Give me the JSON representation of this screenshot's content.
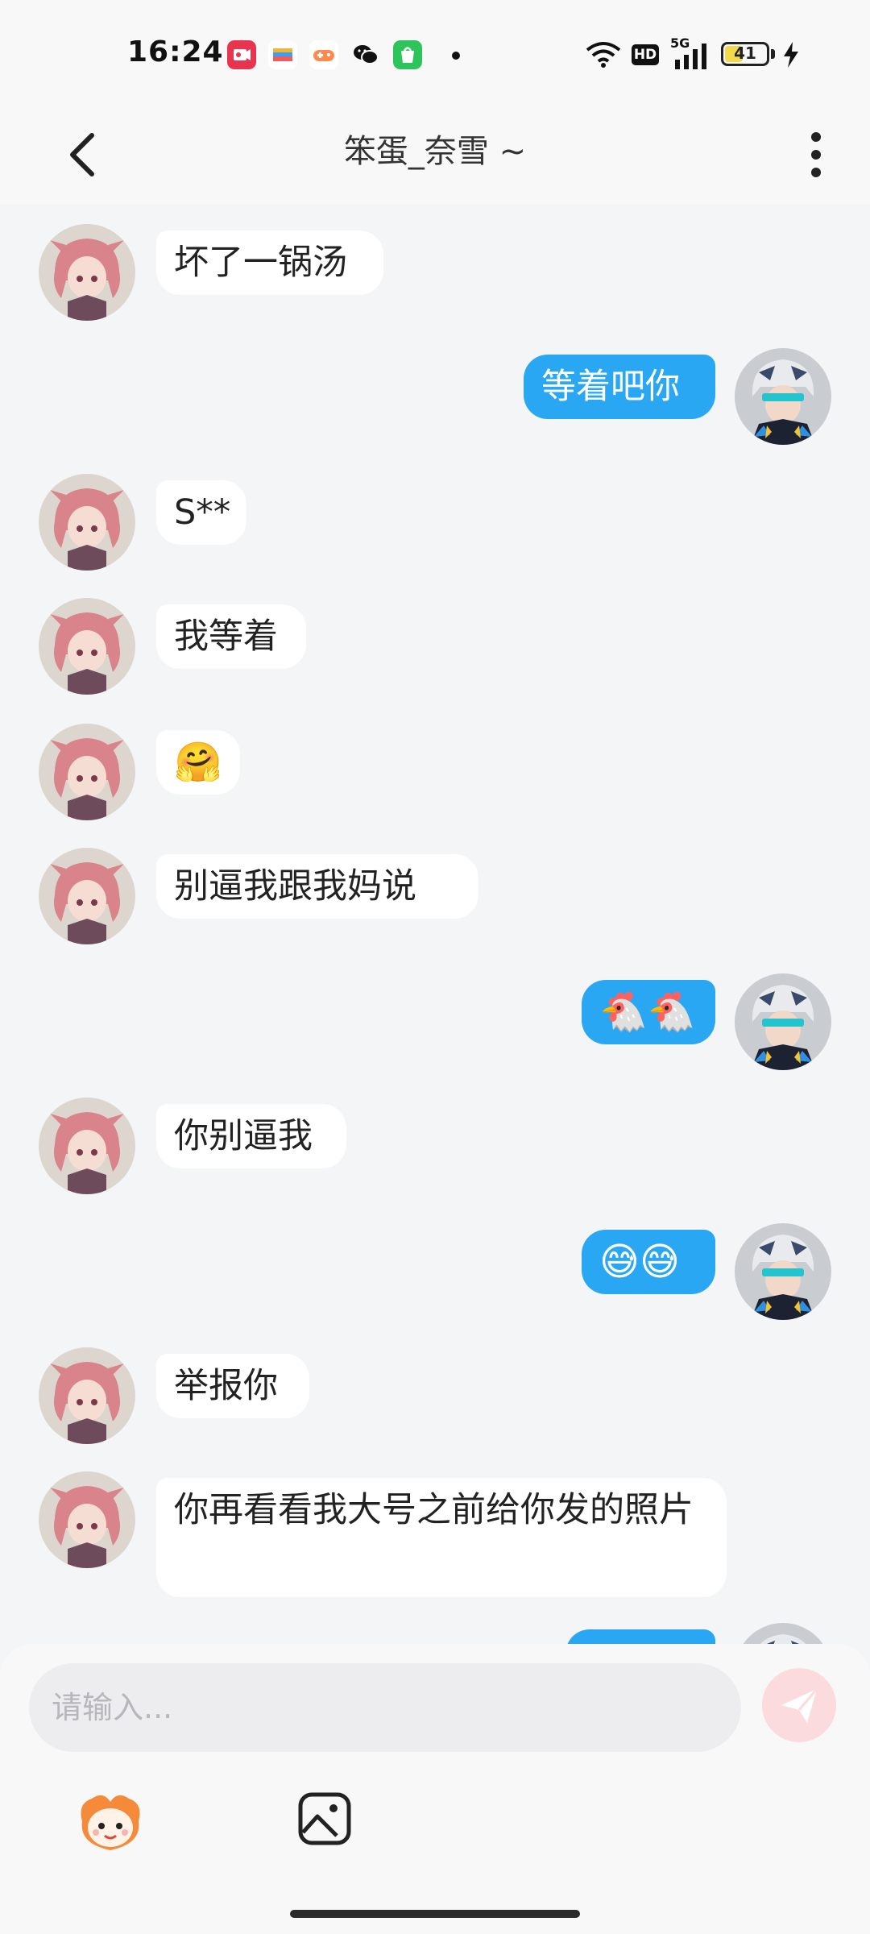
{
  "status_bar": {
    "time": "16:24",
    "battery": "41",
    "network": "5G",
    "hd": "HD",
    "app_icons": [
      "screen-record-icon",
      "wallet-icon",
      "game-center-icon",
      "wechat-icon",
      "app-store-icon"
    ]
  },
  "header": {
    "title": "笨蛋_奈雪 ~"
  },
  "messages": [
    {
      "side": "in",
      "text": "坏了一锅汤"
    },
    {
      "side": "out",
      "text": "等着吧你"
    },
    {
      "side": "in",
      "text": "S**"
    },
    {
      "side": "in",
      "text": "我等着"
    },
    {
      "side": "in",
      "text": "🤗"
    },
    {
      "side": "in",
      "text": "别逼我跟我妈说"
    },
    {
      "side": "out",
      "text": "🐔🐔"
    },
    {
      "side": "in",
      "text": "你别逼我"
    },
    {
      "side": "out",
      "text": "😅😅"
    },
    {
      "side": "in",
      "text": "举报你"
    },
    {
      "side": "in",
      "text": "你再看看我大号之前给你发的照片"
    },
    {
      "side": "out",
      "text": ""
    }
  ],
  "input": {
    "placeholder": "请输入..."
  },
  "colors": {
    "outgoing_bubble": "#2aa7f2",
    "incoming_bubble": "#ffffff",
    "background": "#f4f5f7",
    "send_button": "#fbdbdd"
  }
}
